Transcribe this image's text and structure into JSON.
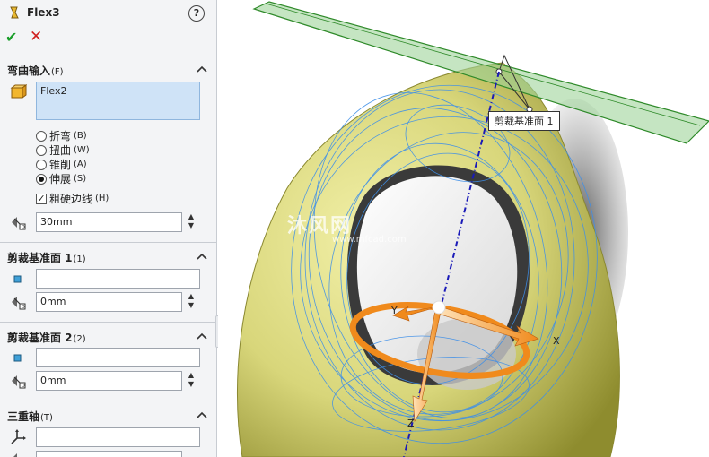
{
  "panel": {
    "title": "Flex3",
    "help_icon": "?",
    "ok_icon": "✔",
    "cancel_icon": "✕"
  },
  "flex_input": {
    "header": "弯曲输入",
    "header_key": "(F)",
    "body_value": "Flex2",
    "options": [
      {
        "label": "折弯",
        "key": "(B)",
        "selected": false
      },
      {
        "label": "扭曲",
        "key": "(W)",
        "selected": false
      },
      {
        "label": "锥削",
        "key": "(A)",
        "selected": false
      },
      {
        "label": "伸展",
        "key": "(S)",
        "selected": true
      }
    ],
    "hard_edges_label": "粗硬边线",
    "hard_edges_key": "(H)",
    "hard_edges_checked": true,
    "distance_value": "30mm"
  },
  "trim_plane_1": {
    "header": "剪裁基准面 1",
    "header_key": "(1)",
    "reference_value": "",
    "offset_value": "0mm"
  },
  "trim_plane_2": {
    "header": "剪裁基准面 2",
    "header_key": "(2)",
    "reference_value": "",
    "offset_value": "0mm"
  },
  "triad": {
    "header": "三重轴",
    "header_key": "(T)",
    "reference_value": ""
  },
  "viewport": {
    "plane_label": "剪裁基准面 1",
    "axis_x": "X",
    "axis_y": "Y",
    "axis_z": "Z",
    "watermark": "沐风网",
    "watermark_sub": "www.mfcad.com",
    "colors": {
      "model": "#d8d67a",
      "model_dark": "#9e9c3a",
      "wire": "#3e8fe8",
      "plane": "#9fd49a",
      "plane_edge": "#2f8a2a",
      "triad": "#f08a1c",
      "axis_line": "#1a1ab8"
    }
  }
}
